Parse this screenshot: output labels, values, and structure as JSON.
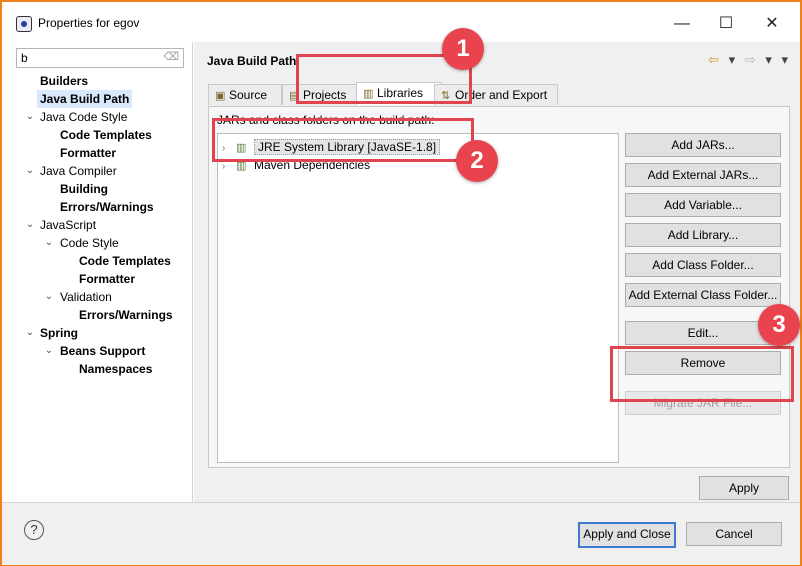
{
  "window": {
    "title": "Properties for egov",
    "minimize_symbol": "—",
    "maximize_symbol": "☐",
    "close_symbol": "✕"
  },
  "filter": {
    "value": "b",
    "clear_symbol": "⌫"
  },
  "tree": [
    {
      "label": "Builders"
    },
    {
      "label": "Java Build Path"
    },
    {
      "label": "Java Code Style"
    },
    {
      "label": "Code Templates"
    },
    {
      "label": "Formatter"
    },
    {
      "label": "Java Compiler"
    },
    {
      "label": "Building"
    },
    {
      "label": "Errors/Warnings"
    },
    {
      "label": "JavaScript"
    },
    {
      "label": "Code Style"
    },
    {
      "label": "Code Templates"
    },
    {
      "label": "Formatter"
    },
    {
      "label": "Validation"
    },
    {
      "label": "Errors/Warnings"
    },
    {
      "label": "Spring"
    },
    {
      "label": "Beans Support"
    },
    {
      "label": "Namespaces"
    }
  ],
  "page": {
    "title": "Java Build Path",
    "back_symbol": "⇦",
    "forward_symbol": "⇨",
    "dropdown_symbol": "▾",
    "menu_symbol": "▾"
  },
  "tabs": [
    {
      "label": "Source",
      "icon": "source-folder-icon"
    },
    {
      "label": "Projects",
      "icon": "projects-icon"
    },
    {
      "label": "Libraries",
      "icon": "libraries-icon"
    },
    {
      "label": "Order and Export",
      "icon": "order-export-icon"
    }
  ],
  "libraries": {
    "label": "JARs and class folders on the build path:",
    "items": [
      {
        "label": "JRE System Library [JavaSE-1.8]"
      },
      {
        "label": "Maven Dependencies"
      }
    ]
  },
  "buttons": {
    "add_jars": "Add JARs...",
    "add_external_jars": "Add External JARs...",
    "add_variable": "Add Variable...",
    "add_library": "Add Library...",
    "add_class_folder": "Add Class Folder...",
    "add_external_class_folder": "Add External Class Folder...",
    "edit": "Edit...",
    "remove": "Remove",
    "migrate_jar": "Migrate JAR File...",
    "apply": "Apply",
    "apply_and_close": "Apply and Close",
    "cancel": "Cancel",
    "help": "?"
  },
  "annotations": {
    "marker_1": "1",
    "marker_2": "2",
    "marker_3": "3"
  },
  "colors": {
    "frame_border": "#f0821e",
    "annotation_red": "#e0444f",
    "primary_button_border": "#3b7bd4"
  }
}
